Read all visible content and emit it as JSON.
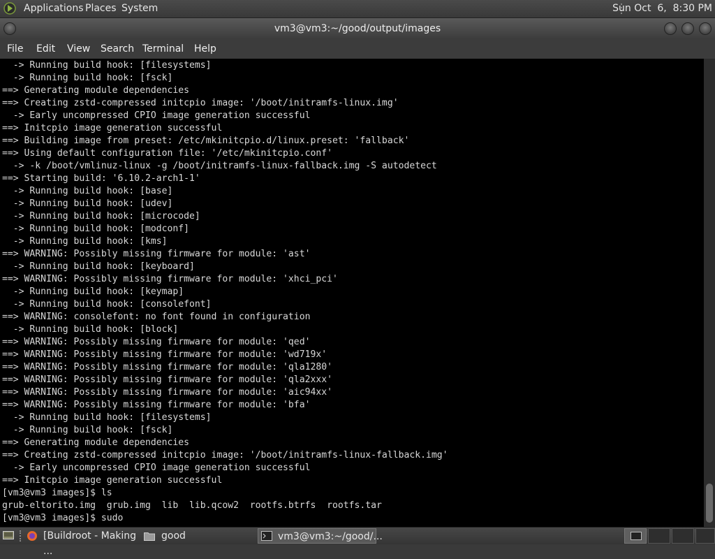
{
  "top_panel": {
    "applications": "Applications",
    "places": "Places",
    "system": "System",
    "clock": "Sun Oct  6,  8:30 PM"
  },
  "window": {
    "title": "vm3@vm3:~/good/output/images"
  },
  "menubar": {
    "file": "File",
    "edit": "Edit",
    "view": "View",
    "search": "Search",
    "terminal": "Terminal",
    "help": "Help"
  },
  "terminal": {
    "lines": [
      "  -> Running build hook: [filesystems]",
      "  -> Running build hook: [fsck]",
      "==> Generating module dependencies",
      "==> Creating zstd-compressed initcpio image: '/boot/initramfs-linux.img'",
      "  -> Early uncompressed CPIO image generation successful",
      "==> Initcpio image generation successful",
      "==> Building image from preset: /etc/mkinitcpio.d/linux.preset: 'fallback'",
      "==> Using default configuration file: '/etc/mkinitcpio.conf'",
      "  -> -k /boot/vmlinuz-linux -g /boot/initramfs-linux-fallback.img -S autodetect",
      "==> Starting build: '6.10.2-arch1-1'",
      "  -> Running build hook: [base]",
      "  -> Running build hook: [udev]",
      "  -> Running build hook: [microcode]",
      "  -> Running build hook: [modconf]",
      "  -> Running build hook: [kms]",
      "==> WARNING: Possibly missing firmware for module: 'ast'",
      "  -> Running build hook: [keyboard]",
      "==> WARNING: Possibly missing firmware for module: 'xhci_pci'",
      "  -> Running build hook: [keymap]",
      "  -> Running build hook: [consolefont]",
      "==> WARNING: consolefont: no font found in configuration",
      "  -> Running build hook: [block]",
      "==> WARNING: Possibly missing firmware for module: 'qed'",
      "==> WARNING: Possibly missing firmware for module: 'wd719x'",
      "==> WARNING: Possibly missing firmware for module: 'qla1280'",
      "==> WARNING: Possibly missing firmware for module: 'qla2xxx'",
      "==> WARNING: Possibly missing firmware for module: 'aic94xx'",
      "==> WARNING: Possibly missing firmware for module: 'bfa'",
      "  -> Running build hook: [filesystems]",
      "  -> Running build hook: [fsck]",
      "==> Generating module dependencies",
      "==> Creating zstd-compressed initcpio image: '/boot/initramfs-linux-fallback.img'",
      "  -> Early uncompressed CPIO image generation successful",
      "==> Initcpio image generation successful",
      "[vm3@vm3 images]$ ls",
      "grub-eltorito.img  grub.img  lib  lib.qcow2  rootfs.btrfs  rootfs.tar",
      "[vm3@vm3 images]$ sudo"
    ]
  },
  "taskbar": {
    "tasks": [
      {
        "label": "[Buildroot - Making ...",
        "icon": "firefox-icon"
      },
      {
        "label": "good",
        "icon": "folder-icon"
      },
      {
        "label": "vm3@vm3:~/good/...",
        "icon": "terminal-icon"
      }
    ]
  },
  "colors": {
    "panel": "#3c3c3c",
    "terminal_bg": "#000000",
    "terminal_fg": "#d8d8d8"
  }
}
